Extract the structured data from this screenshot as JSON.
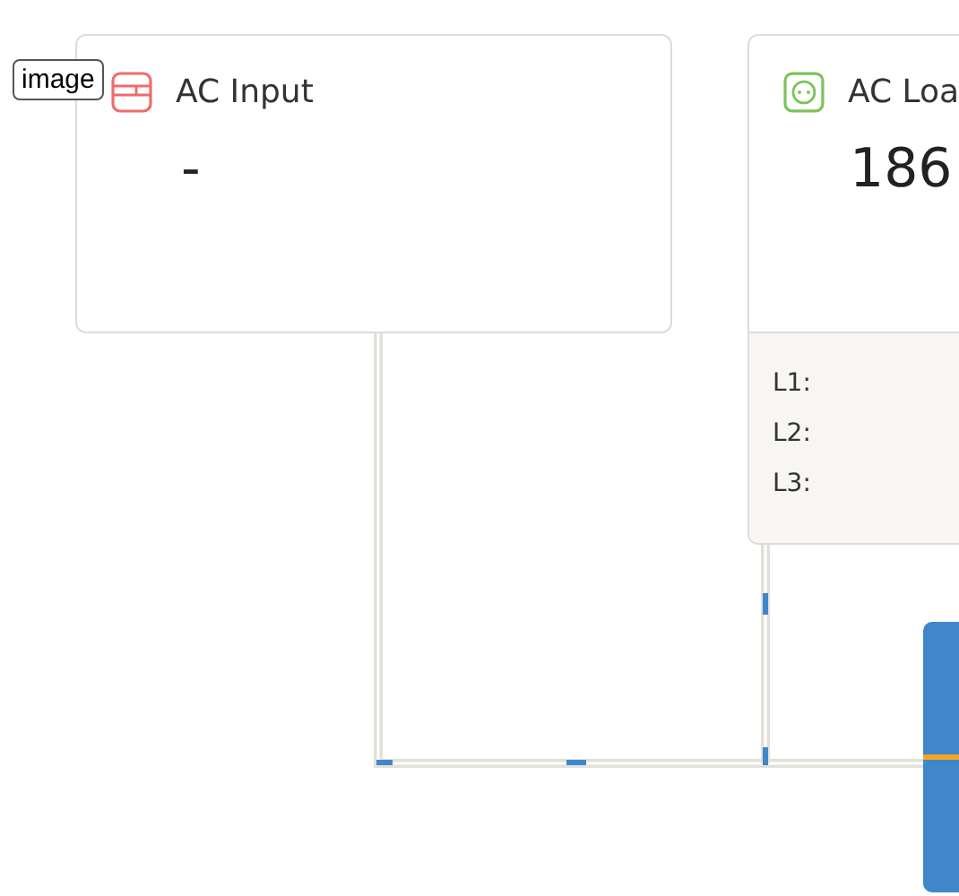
{
  "image_label": "image",
  "ac_input": {
    "title": "AC Input",
    "value": "-"
  },
  "ac_loads": {
    "title": "AC Loa",
    "value": "186",
    "phases": [
      {
        "label": "L1:"
      },
      {
        "label": "L2:"
      },
      {
        "label": "L3:"
      }
    ]
  }
}
